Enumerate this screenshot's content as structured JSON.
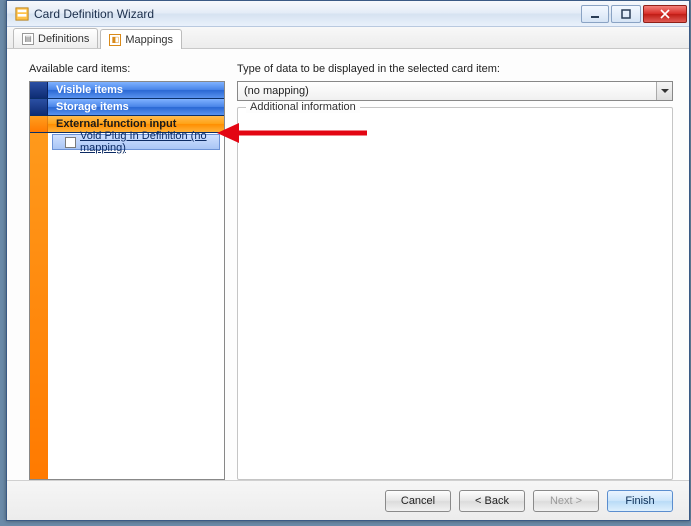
{
  "window": {
    "title": "Card Definition Wizard"
  },
  "tabs": {
    "definitions": "Definitions",
    "mappings": "Mappings"
  },
  "left": {
    "label": "Available card items:",
    "sections": {
      "visible": "Visible items",
      "storage": "Storage items",
      "external": "External-function input"
    },
    "items": [
      {
        "label": "Void Plug In Definition (no mapping)"
      }
    ]
  },
  "right": {
    "type_label": "Type of data to be displayed in the selected card item:",
    "dropdown_value": "(no mapping)",
    "legend": "Additional information"
  },
  "buttons": {
    "cancel": "Cancel",
    "back": "< Back",
    "next": "Next >",
    "finish": "Finish"
  }
}
